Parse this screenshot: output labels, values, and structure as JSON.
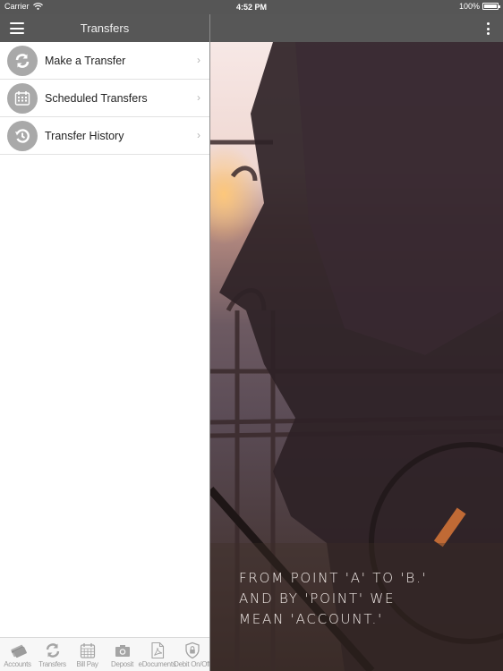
{
  "status_bar": {
    "carrier": "Carrier",
    "time": "4:52 PM",
    "battery": "100%",
    "battery_level": 1.0
  },
  "left_nav": {
    "title": "Transfers",
    "menu_icon": "hamburger-icon"
  },
  "menu": {
    "items": [
      {
        "label": "Make a Transfer",
        "icon": "refresh-arrows-icon"
      },
      {
        "label": "Scheduled Transfers",
        "icon": "calendar-icon"
      },
      {
        "label": "Transfer History",
        "icon": "history-icon"
      }
    ],
    "chevron": "›"
  },
  "tabbar": {
    "tabs": [
      {
        "label": "Accounts",
        "icon": "credit-cards-icon"
      },
      {
        "label": "Transfers",
        "icon": "refresh-arrows-icon"
      },
      {
        "label": "Bill Pay",
        "icon": "calendar-icon"
      },
      {
        "label": "Deposit",
        "icon": "camera-icon"
      },
      {
        "label": "eDocuments",
        "icon": "pdf-document-icon"
      },
      {
        "label": "Debit On/Off",
        "icon": "shield-lock-icon"
      }
    ]
  },
  "right_nav": {
    "menu_icon": "more-vertical-icon"
  },
  "hero": {
    "lines": [
      "FROM POINT 'A' TO 'B.'",
      "AND BY 'POINT' WE",
      "MEAN 'ACCOUNT.'"
    ]
  }
}
